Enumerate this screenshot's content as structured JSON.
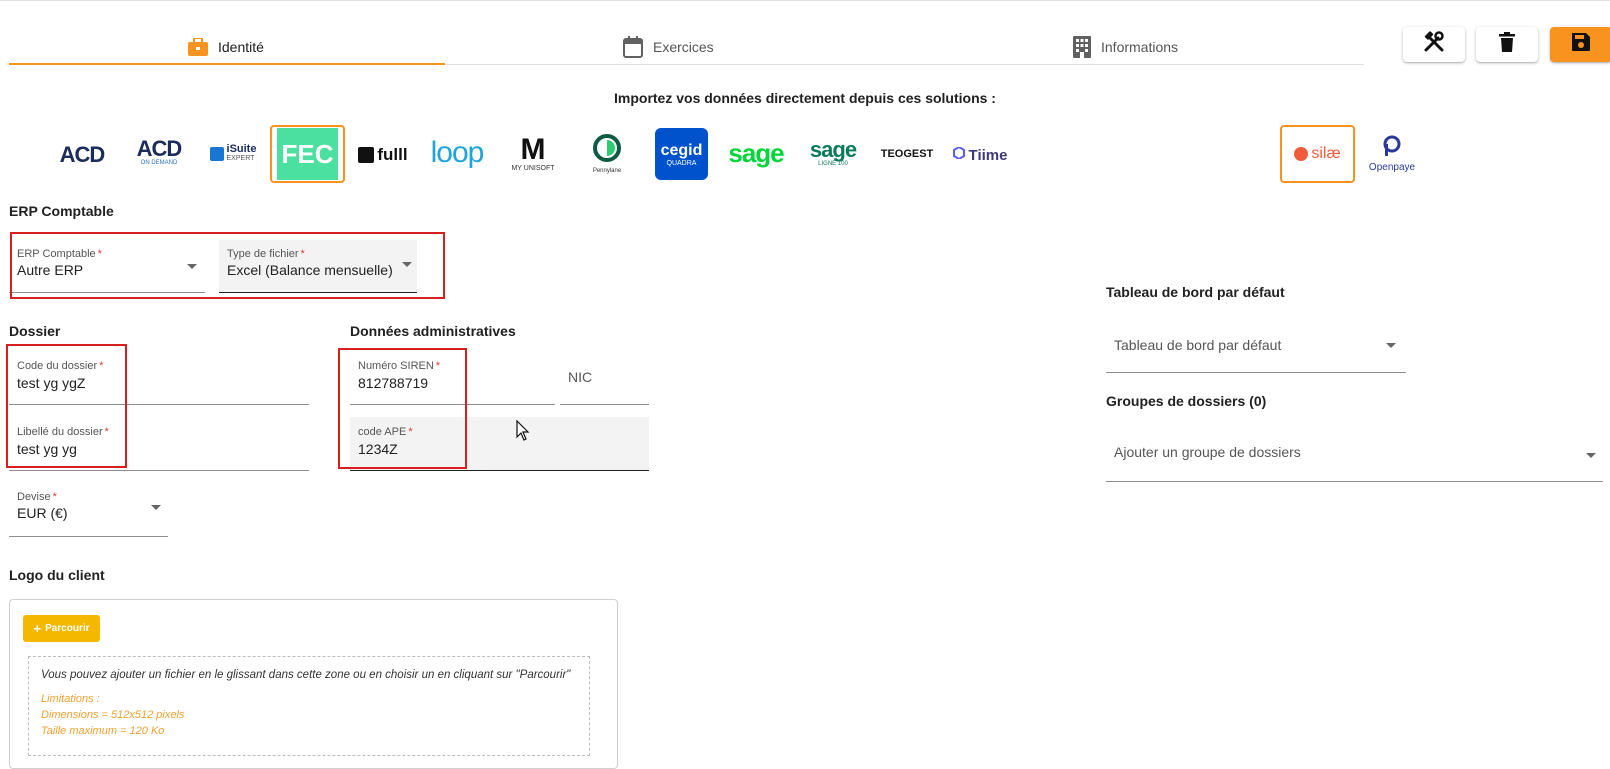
{
  "tabs": [
    {
      "label": "Identité",
      "icon": "briefcase-icon",
      "active": true
    },
    {
      "label": "Exercices",
      "icon": "calendar-icon",
      "active": false
    },
    {
      "label": "Informations",
      "icon": "building-icon",
      "active": false
    }
  ],
  "toolbar": {
    "tools_icon": "tools-icon",
    "delete_icon": "trash-icon",
    "save_icon": "save-icon"
  },
  "import": {
    "title": "Importez vos données directement depuis ces solutions :",
    "logos": {
      "acd": "ACD",
      "acd_ondemand": "ACD",
      "acd_ondemand_sub": "ON DEMAND",
      "isuite": "iSuite",
      "isuite_sub": "EXPERT",
      "fec": "FEC",
      "fulll": "fulll",
      "loop": "loop",
      "myunisoft": "M",
      "myunisoft_sub": "MY UNISOFT",
      "pennylane": "Pennylane",
      "cegid": "cegid",
      "cegid_sub": "QUADRA",
      "sage": "sage",
      "sage100": "sage",
      "sage100_sub": "LIGNE 100",
      "teogest": "TEOGEST",
      "tiime": "Tiime",
      "silae": "silæ",
      "openpaye": "Openpaye"
    },
    "selected": [
      "FEC",
      "silæ"
    ]
  },
  "erp": {
    "section": "ERP Comptable",
    "erp_label": "ERP Comptable",
    "erp_value": "Autre ERP",
    "file_type_label": "Type de fichier",
    "file_type_value": "Excel (Balance mensuelle)"
  },
  "dossier": {
    "section": "Dossier",
    "code_label": "Code du dossier",
    "code_value": "test yg ygZ",
    "libelle_label": "Libellé du dossier",
    "libelle_value": "test yg yg",
    "devise_label": "Devise",
    "devise_value": "EUR (€)"
  },
  "admin": {
    "section": "Données administratives",
    "siren_label": "Numéro SIREN",
    "siren_value": "812788719",
    "nic_placeholder": "NIC",
    "ape_label": "code APE",
    "ape_value": "1234Z"
  },
  "dashboard": {
    "section": "Tableau de bord par défaut",
    "select_placeholder": "Tableau de bord par défaut"
  },
  "groups": {
    "section": "Groupes de dossiers (0)",
    "placeholder": "Ajouter un groupe de dossiers"
  },
  "logo_client": {
    "section": "Logo du client",
    "browse_label": "Parcourir",
    "drop_text": "Vous pouvez ajouter un fichier en le glissant dans cette zone ou en choisir un en cliquant sur \"Parcourir\"",
    "limitations": "Limitations :",
    "dimensions": "Dimensions = 512x512 pixels",
    "max_size": "Taille maximum = 120 Ko"
  },
  "required_marker": "*"
}
